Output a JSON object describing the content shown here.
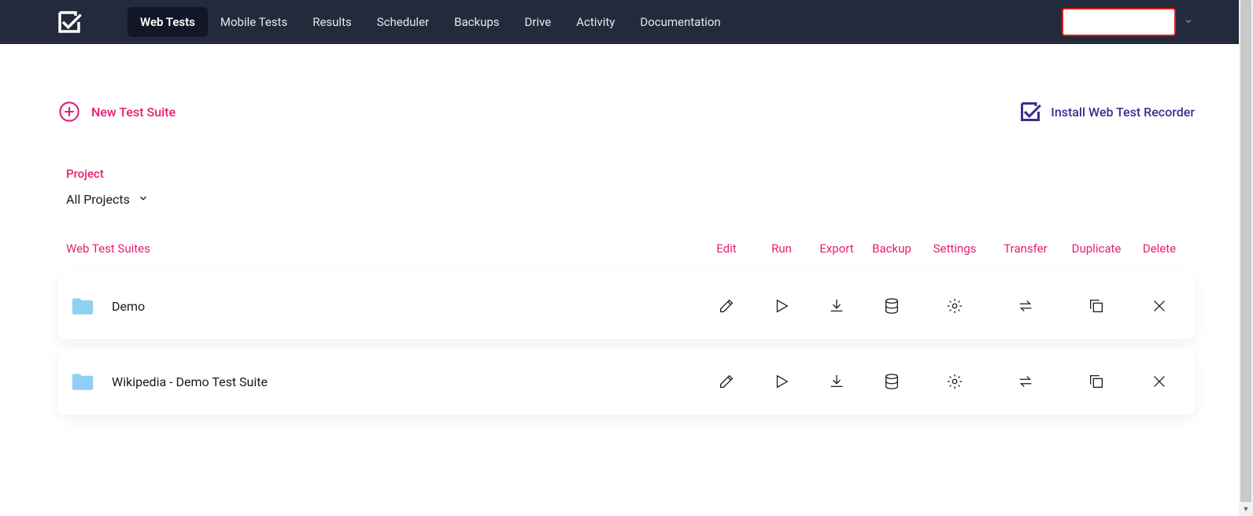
{
  "nav": {
    "items": [
      {
        "label": "Web Tests",
        "active": true
      },
      {
        "label": "Mobile Tests",
        "active": false
      },
      {
        "label": "Results",
        "active": false
      },
      {
        "label": "Scheduler",
        "active": false
      },
      {
        "label": "Backups",
        "active": false
      },
      {
        "label": "Drive",
        "active": false
      },
      {
        "label": "Activity",
        "active": false
      },
      {
        "label": "Documentation",
        "active": false
      }
    ]
  },
  "actions": {
    "new_suite_label": "New Test Suite",
    "install_recorder_label": "Install Web Test Recorder"
  },
  "project": {
    "label": "Project",
    "selected": "All Projects"
  },
  "table": {
    "headers": {
      "name": "Web Test Suites",
      "edit": "Edit",
      "run": "Run",
      "export": "Export",
      "backup": "Backup",
      "settings": "Settings",
      "transfer": "Transfer",
      "duplicate": "Duplicate",
      "delete": "Delete"
    },
    "rows": [
      {
        "name": "Demo"
      },
      {
        "name": "Wikipedia - Demo Test Suite"
      }
    ]
  }
}
